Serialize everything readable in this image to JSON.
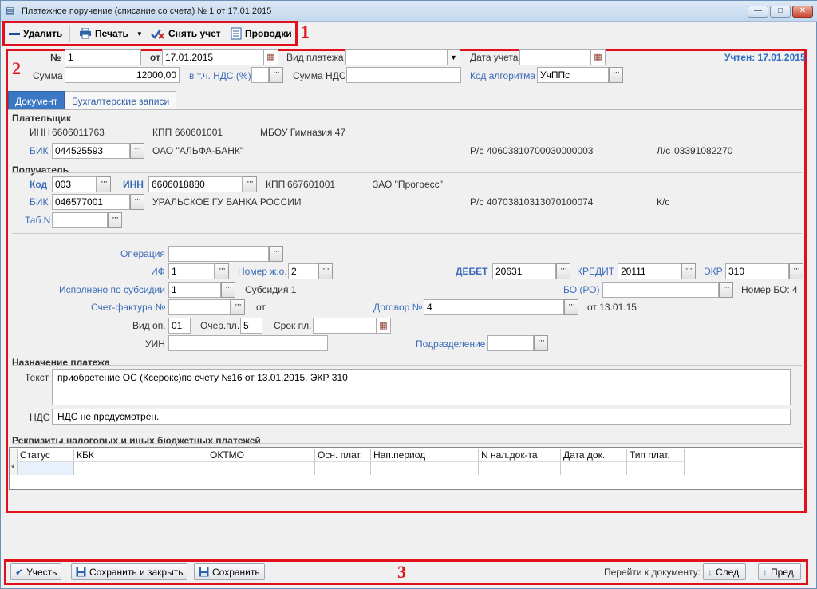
{
  "window": {
    "title": "Платежное поручение (списание со счета) № 1 от 17.01.2015",
    "controls": [
      "—",
      "□",
      "✕"
    ]
  },
  "toolbar": {
    "delete_label": "Удалить",
    "print_label": "Печать",
    "unpost_label": "Снять учет",
    "entries_label": "Проводки"
  },
  "callouts": {
    "toolbar": "1",
    "form": "2",
    "footer": "3"
  },
  "header": {
    "num_label": "№",
    "num_value": "1",
    "date_label": "от",
    "date_value": "17.01.2015",
    "paytype_label": "Вид платежа",
    "paytype_value": "",
    "accdate_label": "Дата учета",
    "accdate_value": "",
    "posted_status": "Учтен: 17.01.2015",
    "sum_label": "Сумма",
    "sum_value": "12000,00",
    "vat_pct_label": "в т.ч. НДС (%)",
    "vat_pct_value": "",
    "vat_sum_label": "Сумма НДС",
    "vat_sum_value": "",
    "algo_label": "Код алгоритма",
    "algo_value": "УчППс"
  },
  "tabs": [
    "Документ",
    "Бухгалтерские записи"
  ],
  "payer": {
    "title": "Плательщик",
    "inn_label": "ИНН",
    "inn_value": "6606011763",
    "kpp_label": "КПП",
    "kpp_value": "660601001",
    "name": "МБОУ Гимназия 47",
    "bik_label": "БИК",
    "bik_value": "044525593",
    "bank_name": "ОАО \"АЛЬФА-БАНК\"",
    "rs_label": "Р/с",
    "rs_value": "40603810700030000003",
    "ls_label": "Л/с",
    "ls_value": "03391082270"
  },
  "recipient": {
    "title": "Получатель",
    "code_label": "Код",
    "code_value": "003",
    "inn_label": "ИНН",
    "inn_value": "6606018880",
    "kpp_label": "КПП",
    "kpp_value": "667601001",
    "name": "ЗАО \"Прогресс\"",
    "bik_label": "БИК",
    "bik_value": "046577001",
    "bank_name": "УРАЛЬСКОЕ ГУ БАНКА РОССИИ",
    "rs_label": "Р/с",
    "rs_value": "40703810313070100074",
    "ks_label": "К/с",
    "tab_label": "Таб.N",
    "tab_value": ""
  },
  "details": {
    "operation_label": "Операция",
    "operation_value": "",
    "if_label": "ИФ",
    "if_value": "1",
    "jo_label": "Номер ж.о.",
    "jo_value": "2",
    "debit_label": "ДЕБЕТ",
    "debit_value": "20631",
    "credit_label": "КРЕДИТ",
    "credit_value": "20111",
    "ekr_label": "ЭКР",
    "ekr_value": "310",
    "subsidy_label": "Исполнено по субсидии",
    "subsidy_value": "1",
    "subsidy_name": "Субсидия 1",
    "bo_label": "БО (РО)",
    "bo_value": "",
    "bo_num": "Номер БО: 4",
    "invoice_label": "Счет-фактура №",
    "invoice_value": "",
    "invoice_from": "от",
    "contract_label": "Договор №",
    "contract_value": "4",
    "contract_date": "от 13.01.15",
    "opkind_label": "Вид оп.",
    "opkind_value": "01",
    "queue_label": "Очер.пл.",
    "queue_value": "5",
    "term_label": "Срок пл.",
    "term_value": "",
    "uin_label": "УИН",
    "uin_value": "",
    "division_label": "Подразделение",
    "division_value": ""
  },
  "purpose": {
    "title": "Назначение платежа",
    "text_label": "Текст",
    "text_value": "приобретение ОС (Ксерокс)по счету №16 от 13.01.2015, ЭКР 310",
    "vat_label": "НДС",
    "vat_value": "НДС не предусмотрен."
  },
  "tax": {
    "title": "Реквизиты налоговых и иных бюджетных платежей",
    "columns": [
      "Статус",
      "КБК",
      "ОКТМО",
      "Осн. плат.",
      "Нап.период",
      "N нал.док-та",
      "Дата док.",
      "Тип плат."
    ],
    "new_row_marker": "*"
  },
  "footer": {
    "post_label": "Учесть",
    "save_close_label": "Сохранить и закрыть",
    "save_label": "Сохранить",
    "goto_label": "Перейти к документу:",
    "next_label": "След.",
    "prev_label": "Пред."
  }
}
